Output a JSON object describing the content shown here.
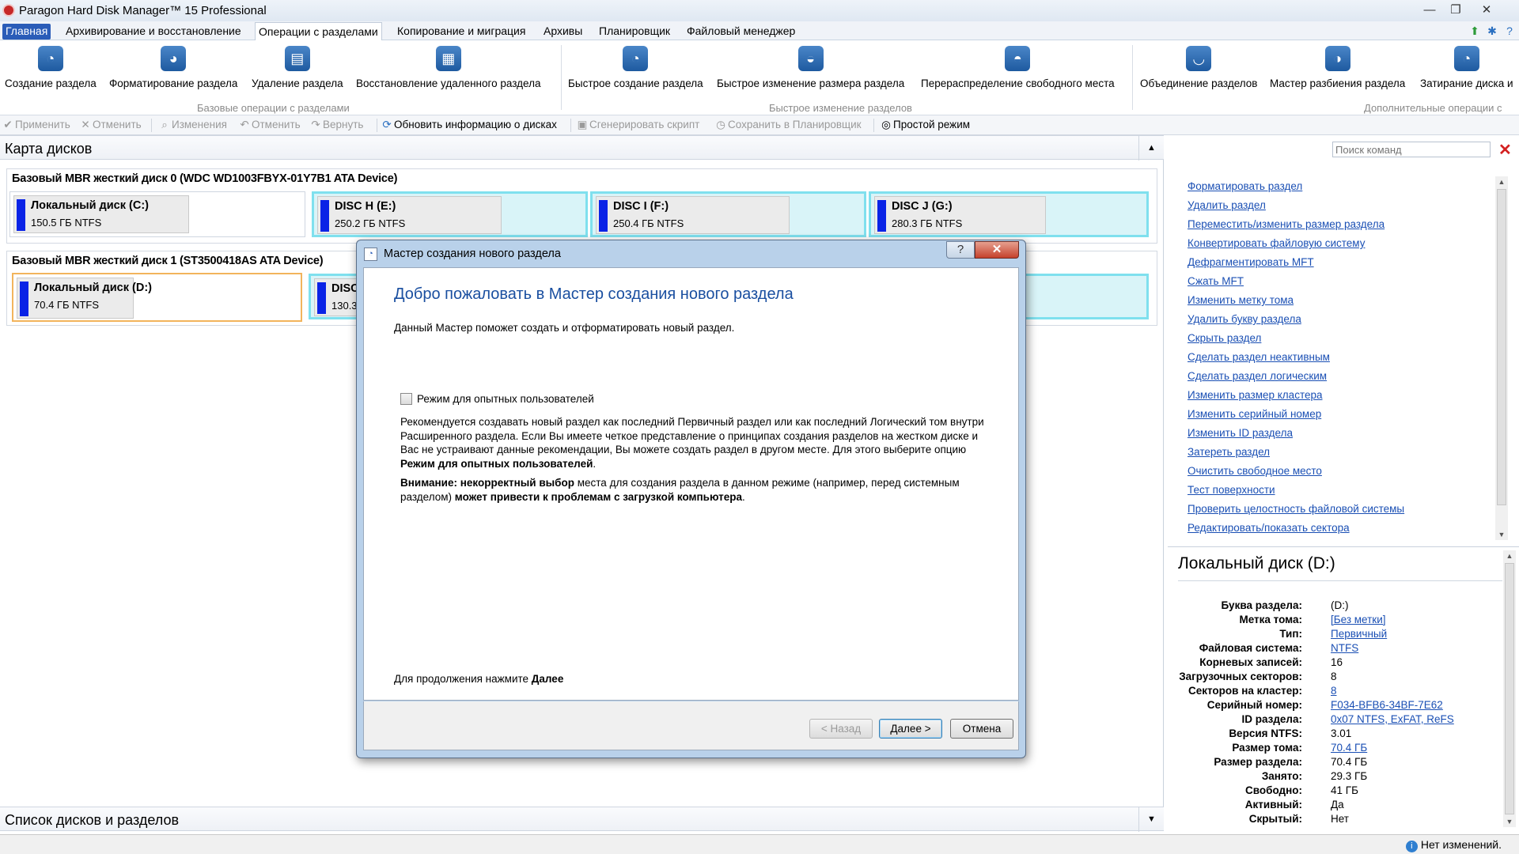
{
  "window": {
    "title": "Paragon Hard Disk Manager™ 15 Professional"
  },
  "menu": [
    "Главная",
    "Архивирование и восстановление",
    "Операции с разделами",
    "Копирование и миграция",
    "Архивы",
    "Планировщик",
    "Файловый менеджер"
  ],
  "ribbon": {
    "buttons": [
      "Создание раздела",
      "Форматирование раздела",
      "Удаление раздела",
      "Восстановление удаленного раздела",
      "Быстрое создание раздела",
      "Быстрое изменение размера раздела",
      "Перераспределение свободного места",
      "Объединение разделов",
      "Мастер разбиения раздела",
      "Затирание диска и"
    ],
    "groups": [
      "Базовые операции с разделами",
      "Быстрое изменение разделов",
      "Дополнительные операции с"
    ]
  },
  "toolbar": [
    "Применить",
    "Отменить",
    "Изменения",
    "Отменить",
    "Вернуть",
    "Обновить информацию о дисках",
    "Сгенерировать скрипт",
    "Сохранить в Планировщик",
    "Простой режим"
  ],
  "diskmap": {
    "title": "Карта дисков",
    "disks": [
      {
        "title": "Базовый MBR жесткий диск 0 (WDC WD1003FBYX-01Y7B1 ATA Device)",
        "partitions": [
          {
            "name": "Локальный диск (C:)",
            "size": "150.5 ГБ NTFS"
          },
          {
            "name": "DISC H (E:)",
            "size": "250.2 ГБ NTFS"
          },
          {
            "name": "DISC I (F:)",
            "size": "250.4 ГБ NTFS"
          },
          {
            "name": "DISC J (G:)",
            "size": "280.3 ГБ NTFS"
          }
        ]
      },
      {
        "title": "Базовый MBR жесткий диск 1 (ST3500418AS ATA Device)",
        "partitions": [
          {
            "name": "Локальный диск (D:)",
            "size": "70.4 ГБ NTFS"
          },
          {
            "name": "DISC",
            "size": "130.3"
          }
        ]
      }
    ]
  },
  "disklist": {
    "title": "Список дисков и разделов"
  },
  "commands": {
    "search_placeholder": "Поиск команд",
    "items": [
      "Форматировать раздел",
      "Удалить раздел",
      "Переместить/изменить размер раздела",
      "Конвертировать файловую систему",
      "Дефрагментировать MFT",
      "Сжать MFT",
      "Изменить метку тома",
      "Удалить букву раздела",
      "Скрыть раздел",
      "Сделать раздел неактивным",
      "Сделать раздел логическим",
      "Изменить размер кластера",
      "Изменить серийный номер",
      "Изменить ID раздела",
      "Затереть раздел",
      "Очистить свободное место",
      "Тест поверхности",
      "Проверить целостность файловой системы",
      "Редактировать/показать сектора"
    ]
  },
  "properties": {
    "title": "Локальный диск (D:)",
    "rows": [
      {
        "label": "Буква раздела:",
        "value": "(D:)",
        "link": false
      },
      {
        "label": "Метка тома:",
        "value": "[Без метки]",
        "link": true
      },
      {
        "label": "Тип:",
        "value": "Первичный",
        "link": true
      },
      {
        "label": "Файловая система:",
        "value": "NTFS",
        "link": true
      },
      {
        "label": "Корневых записей:",
        "value": "16",
        "link": false
      },
      {
        "label": "Загрузочных секторов:",
        "value": "8",
        "link": false
      },
      {
        "label": "Секторов на кластер:",
        "value": "8",
        "link": true
      },
      {
        "label": "Серийный номер:",
        "value": "F034-BFB6-34BF-7E62",
        "link": true
      },
      {
        "label": "ID раздела:",
        "value": "0x07 NTFS, ExFAT, ReFS",
        "link": true
      },
      {
        "label": "Версия NTFS:",
        "value": "3.01",
        "link": false
      },
      {
        "label": "Размер тома:",
        "value": "70.4 ГБ",
        "link": true
      },
      {
        "label": "Размер раздела:",
        "value": "70.4 ГБ",
        "link": false
      },
      {
        "label": "Занято:",
        "value": "29.3 ГБ",
        "link": false
      },
      {
        "label": "Свободно:",
        "value": "41 ГБ",
        "link": false
      },
      {
        "label": "Активный:",
        "value": "Да",
        "link": false
      },
      {
        "label": "Скрытый:",
        "value": "Нет",
        "link": false
      }
    ]
  },
  "status": {
    "text": "Нет изменений."
  },
  "dialog": {
    "title": "Мастер создания нового раздела",
    "heading": "Добро пожаловать в Мастер создания нового раздела",
    "subtitle": "Данный Мастер поможет создать и отформатировать новый раздел.",
    "checkbox_label": "Режим для опытных пользователей",
    "para1": "Рекомендуется создавать новый раздел как последний Первичный раздел или как последний Логический том внутри Расширенного раздела. Если Вы имеете четкое представление о принципах создания разделов на жестком диске и Вас не устраивают данные рекомендации, Вы можете создать раздел в другом месте. Для этого выберите опцию",
    "para1_bold": "Режим для опытных пользователей",
    "para2_bold1": "Внимание: некорректный выбор",
    "para2_mid": " места для создания раздела в данном режиме (например, перед системным разделом) ",
    "para2_bold2": "может привести к проблемам с загрузкой компьютера",
    "continue_prefix": "Для продолжения нажмите ",
    "continue_bold": "Далее",
    "buttons": {
      "back": "< Назад",
      "next": "Далее >",
      "cancel": "Отмена"
    }
  }
}
